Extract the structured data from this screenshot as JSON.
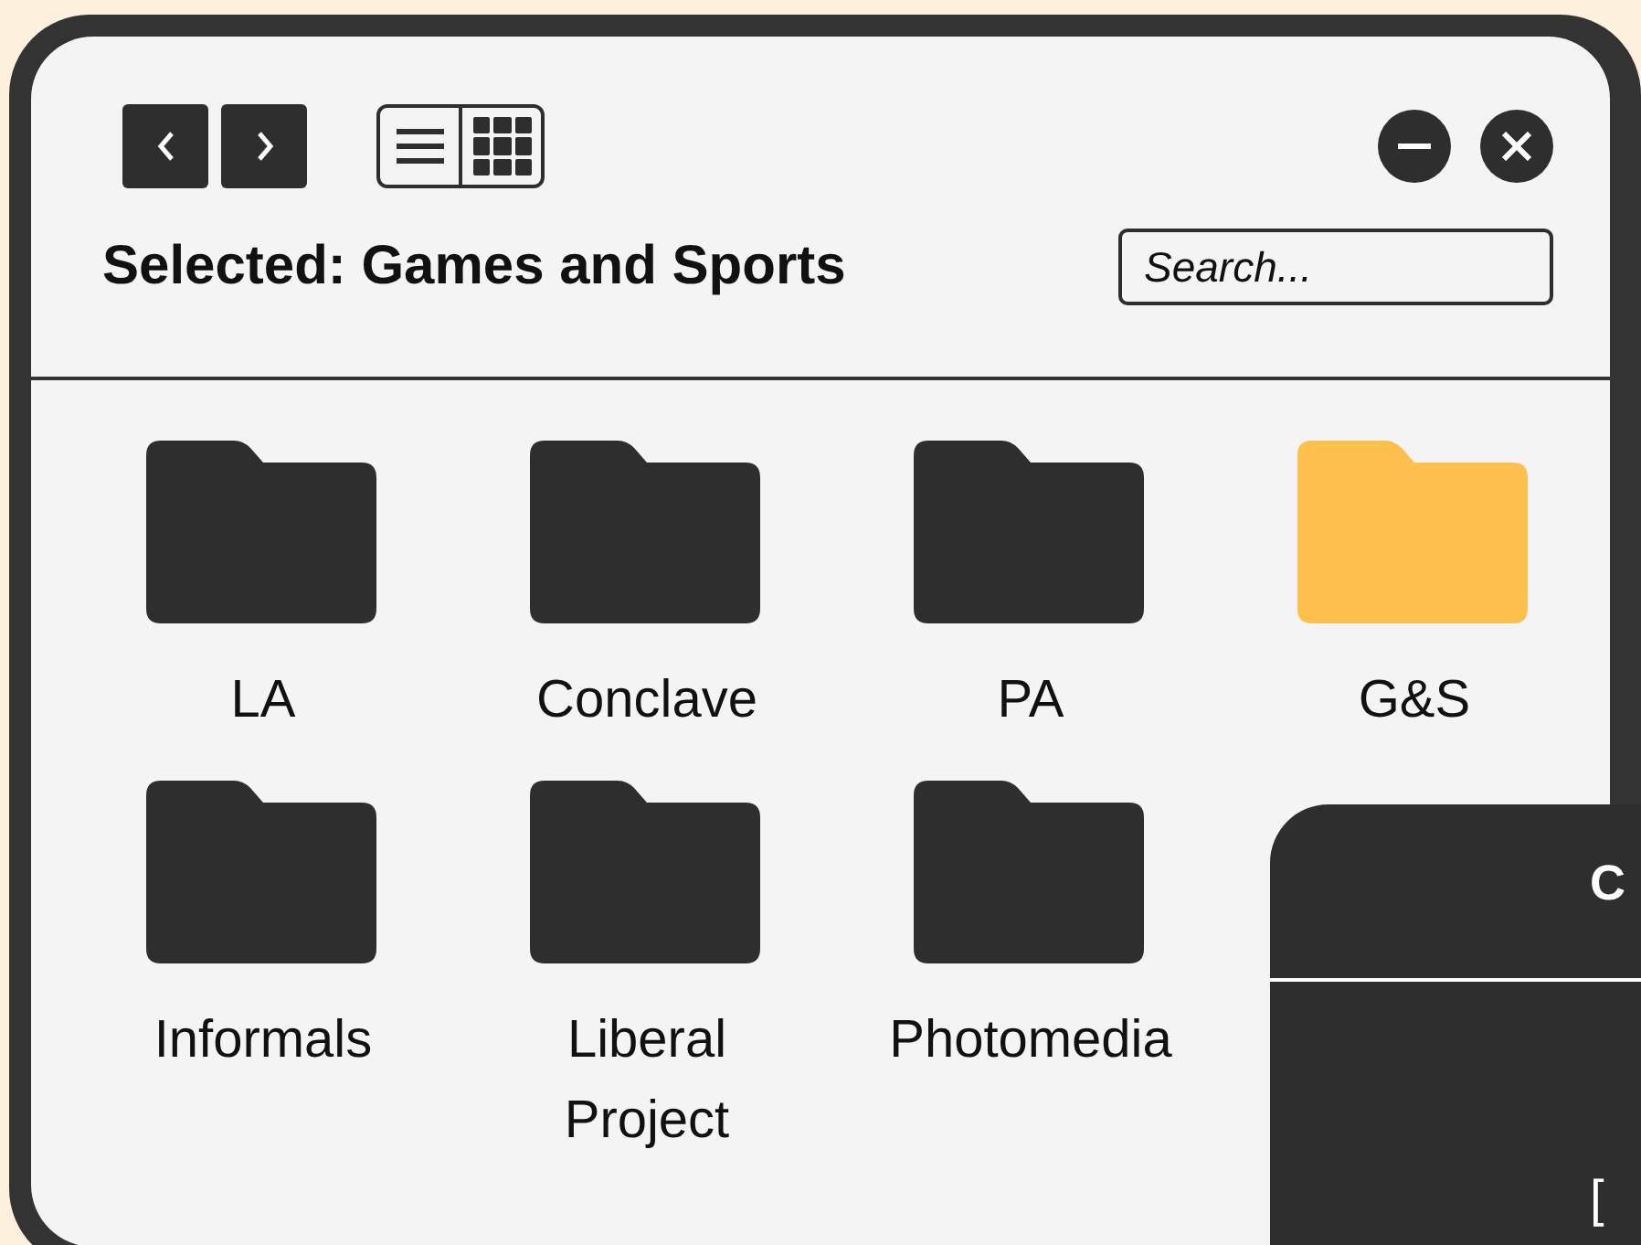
{
  "header": {
    "heading": "Selected: Games and Sports",
    "search": {
      "placeholder": "Search..."
    }
  },
  "folders": [
    {
      "label": "LA",
      "selected": false
    },
    {
      "label": "Conclave",
      "selected": false
    },
    {
      "label": "PA",
      "selected": false
    },
    {
      "label": "G&S",
      "selected": true
    },
    {
      "label": "Informals",
      "selected": false
    },
    {
      "label": "Liberal Project",
      "selected": false
    },
    {
      "label": "Photomedia",
      "selected": false
    }
  ],
  "overlay_panel": {
    "title": "C",
    "text": "["
  }
}
